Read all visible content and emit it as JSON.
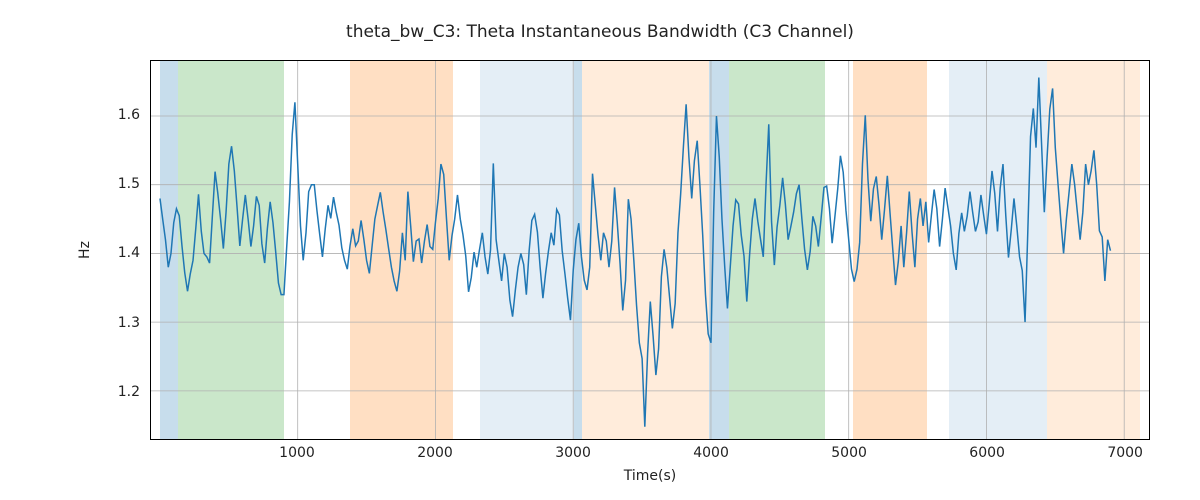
{
  "chart_data": {
    "type": "line",
    "title": "theta_bw_C3: Theta Instantaneous Bandwidth (C3 Channel)",
    "xlabel": "Time(s)",
    "ylabel": "Hz",
    "xlim": [
      -65,
      7180
    ],
    "ylim": [
      1.13,
      1.68
    ],
    "xticks": [
      1000,
      2000,
      3000,
      4000,
      5000,
      6000,
      7000
    ],
    "yticks": [
      1.2,
      1.3,
      1.4,
      1.5,
      1.6
    ],
    "regions": [
      {
        "x0": 0,
        "x1": 130,
        "color": "blue"
      },
      {
        "x0": 130,
        "x1": 900,
        "color": "green"
      },
      {
        "x0": 1380,
        "x1": 2120,
        "color": "orange"
      },
      {
        "x0": 2320,
        "x1": 3000,
        "color": "lblue"
      },
      {
        "x0": 3000,
        "x1": 3060,
        "color": "blue"
      },
      {
        "x0": 3060,
        "x1": 3980,
        "color": "lorange"
      },
      {
        "x0": 3980,
        "x1": 4120,
        "color": "blue"
      },
      {
        "x0": 4120,
        "x1": 4820,
        "color": "green"
      },
      {
        "x0": 5020,
        "x1": 5560,
        "color": "orange"
      },
      {
        "x0": 5720,
        "x1": 6430,
        "color": "lblue"
      },
      {
        "x0": 6430,
        "x1": 7100,
        "color": "lorange"
      }
    ],
    "x": [
      0,
      20,
      40,
      60,
      80,
      100,
      120,
      140,
      160,
      180,
      200,
      220,
      240,
      260,
      280,
      300,
      320,
      340,
      360,
      380,
      400,
      420,
      440,
      460,
      480,
      500,
      520,
      540,
      560,
      580,
      600,
      620,
      640,
      660,
      680,
      700,
      720,
      740,
      760,
      780,
      800,
      820,
      840,
      860,
      880,
      900,
      920,
      940,
      960,
      980,
      1000,
      1020,
      1040,
      1060,
      1080,
      1100,
      1120,
      1140,
      1160,
      1180,
      1200,
      1220,
      1240,
      1260,
      1280,
      1300,
      1320,
      1340,
      1360,
      1380,
      1400,
      1420,
      1440,
      1460,
      1480,
      1500,
      1520,
      1540,
      1560,
      1580,
      1600,
      1620,
      1640,
      1660,
      1680,
      1700,
      1720,
      1740,
      1760,
      1780,
      1800,
      1820,
      1840,
      1860,
      1880,
      1900,
      1920,
      1940,
      1960,
      1980,
      2000,
      2020,
      2040,
      2060,
      2080,
      2100,
      2120,
      2140,
      2160,
      2180,
      2200,
      2220,
      2240,
      2260,
      2280,
      2300,
      2320,
      2340,
      2360,
      2380,
      2400,
      2420,
      2440,
      2460,
      2480,
      2500,
      2520,
      2540,
      2560,
      2580,
      2600,
      2620,
      2640,
      2660,
      2680,
      2700,
      2720,
      2740,
      2760,
      2780,
      2800,
      2820,
      2840,
      2860,
      2880,
      2900,
      2920,
      2940,
      2960,
      2980,
      3000,
      3020,
      3040,
      3060,
      3080,
      3100,
      3120,
      3140,
      3160,
      3180,
      3200,
      3220,
      3240,
      3260,
      3280,
      3300,
      3320,
      3340,
      3360,
      3380,
      3400,
      3420,
      3440,
      3460,
      3480,
      3500,
      3520,
      3540,
      3560,
      3580,
      3600,
      3620,
      3640,
      3660,
      3680,
      3700,
      3720,
      3740,
      3760,
      3780,
      3800,
      3820,
      3840,
      3860,
      3880,
      3900,
      3920,
      3940,
      3960,
      3980,
      4000,
      4020,
      4040,
      4060,
      4080,
      4100,
      4120,
      4140,
      4160,
      4180,
      4200,
      4220,
      4240,
      4260,
      4280,
      4300,
      4320,
      4340,
      4360,
      4380,
      4400,
      4420,
      4440,
      4460,
      4480,
      4500,
      4520,
      4540,
      4560,
      4580,
      4600,
      4620,
      4640,
      4660,
      4680,
      4700,
      4720,
      4740,
      4760,
      4780,
      4800,
      4820,
      4840,
      4860,
      4880,
      4900,
      4920,
      4940,
      4960,
      4980,
      5000,
      5020,
      5040,
      5060,
      5080,
      5100,
      5120,
      5140,
      5160,
      5180,
      5200,
      5220,
      5240,
      5260,
      5280,
      5300,
      5320,
      5340,
      5360,
      5380,
      5400,
      5420,
      5440,
      5460,
      5480,
      5500,
      5520,
      5540,
      5560,
      5580,
      5600,
      5620,
      5640,
      5660,
      5680,
      5700,
      5720,
      5740,
      5760,
      5780,
      5800,
      5820,
      5840,
      5860,
      5880,
      5900,
      5920,
      5940,
      5960,
      5980,
      6000,
      6020,
      6040,
      6060,
      6080,
      6100,
      6120,
      6140,
      6160,
      6180,
      6200,
      6220,
      6240,
      6260,
      6280,
      6300,
      6320,
      6340,
      6360,
      6380,
      6400,
      6420,
      6440,
      6460,
      6480,
      6500,
      6520,
      6540,
      6560,
      6580,
      6600,
      6620,
      6640,
      6660,
      6680,
      6700,
      6720,
      6740,
      6760,
      6780,
      6800,
      6820,
      6840,
      6860,
      6880,
      6900,
      6920,
      6940,
      6960,
      6980,
      7000,
      7020,
      7040,
      7060,
      7080,
      7100
    ],
    "values": [
      1.48,
      1.45,
      1.42,
      1.38,
      1.4,
      1.445,
      1.465,
      1.455,
      1.41,
      1.372,
      1.345,
      1.37,
      1.39,
      1.437,
      1.486,
      1.432,
      1.4,
      1.395,
      1.386,
      1.452,
      1.519,
      1.488,
      1.45,
      1.407,
      1.46,
      1.53,
      1.556,
      1.52,
      1.466,
      1.411,
      1.45,
      1.485,
      1.45,
      1.41,
      1.44,
      1.483,
      1.47,
      1.414,
      1.386,
      1.436,
      1.475,
      1.445,
      1.403,
      1.357,
      1.34,
      1.34,
      1.41,
      1.475,
      1.573,
      1.62,
      1.53,
      1.44,
      1.39,
      1.43,
      1.49,
      1.5,
      1.5,
      1.462,
      1.427,
      1.395,
      1.436,
      1.47,
      1.451,
      1.482,
      1.46,
      1.441,
      1.408,
      1.39,
      1.377,
      1.411,
      1.436,
      1.411,
      1.418,
      1.448,
      1.42,
      1.39,
      1.371,
      1.41,
      1.45,
      1.47,
      1.489,
      1.46,
      1.435,
      1.407,
      1.38,
      1.36,
      1.345,
      1.374,
      1.43,
      1.39,
      1.49,
      1.44,
      1.388,
      1.418,
      1.421,
      1.386,
      1.418,
      1.442,
      1.41,
      1.406,
      1.445,
      1.48,
      1.53,
      1.515,
      1.45,
      1.39,
      1.426,
      1.45,
      1.485,
      1.45,
      1.427,
      1.396,
      1.344,
      1.365,
      1.402,
      1.38,
      1.406,
      1.43,
      1.395,
      1.37,
      1.405,
      1.531,
      1.42,
      1.39,
      1.36,
      1.4,
      1.38,
      1.332,
      1.308,
      1.347,
      1.38,
      1.4,
      1.384,
      1.34,
      1.404,
      1.448,
      1.457,
      1.431,
      1.38,
      1.335,
      1.371,
      1.403,
      1.43,
      1.412,
      1.464,
      1.456,
      1.404,
      1.37,
      1.335,
      1.303,
      1.376,
      1.42,
      1.444,
      1.395,
      1.361,
      1.347,
      1.38,
      1.516,
      1.472,
      1.427,
      1.39,
      1.43,
      1.418,
      1.38,
      1.418,
      1.496,
      1.445,
      1.385,
      1.317,
      1.361,
      1.479,
      1.45,
      1.39,
      1.325,
      1.27,
      1.247,
      1.148,
      1.255,
      1.33,
      1.28,
      1.223,
      1.261,
      1.366,
      1.406,
      1.379,
      1.335,
      1.291,
      1.327,
      1.43,
      1.486,
      1.556,
      1.617,
      1.54,
      1.48,
      1.535,
      1.564,
      1.5,
      1.427,
      1.34,
      1.283,
      1.27,
      1.46,
      1.6,
      1.54,
      1.45,
      1.38,
      1.32,
      1.38,
      1.44,
      1.478,
      1.472,
      1.427,
      1.396,
      1.33,
      1.396,
      1.45,
      1.48,
      1.447,
      1.42,
      1.395,
      1.502,
      1.588,
      1.446,
      1.383,
      1.438,
      1.47,
      1.51,
      1.472,
      1.42,
      1.439,
      1.46,
      1.487,
      1.5,
      1.45,
      1.406,
      1.376,
      1.403,
      1.454,
      1.44,
      1.41,
      1.452,
      1.496,
      1.498,
      1.465,
      1.415,
      1.454,
      1.494,
      1.542,
      1.518,
      1.463,
      1.42,
      1.377,
      1.359,
      1.377,
      1.416,
      1.53,
      1.601,
      1.508,
      1.447,
      1.494,
      1.512,
      1.47,
      1.42,
      1.464,
      1.513,
      1.459,
      1.405,
      1.354,
      1.388,
      1.44,
      1.38,
      1.43,
      1.49,
      1.43,
      1.38,
      1.45,
      1.48,
      1.44,
      1.475,
      1.416,
      1.455,
      1.493,
      1.465,
      1.41,
      1.45,
      1.495,
      1.467,
      1.44,
      1.4,
      1.376,
      1.429,
      1.459,
      1.432,
      1.454,
      1.49,
      1.46,
      1.432,
      1.446,
      1.485,
      1.455,
      1.428,
      1.472,
      1.52,
      1.488,
      1.432,
      1.495,
      1.53,
      1.455,
      1.394,
      1.435,
      1.48,
      1.44,
      1.395,
      1.375,
      1.3,
      1.429,
      1.57,
      1.611,
      1.554,
      1.656,
      1.561,
      1.46,
      1.54,
      1.61,
      1.64,
      1.554,
      1.5,
      1.447,
      1.4,
      1.45,
      1.489,
      1.53,
      1.5,
      1.46,
      1.42,
      1.46,
      1.53,
      1.5,
      1.52,
      1.55,
      1.5,
      1.433,
      1.424,
      1.36,
      1.42,
      1.404
    ]
  }
}
